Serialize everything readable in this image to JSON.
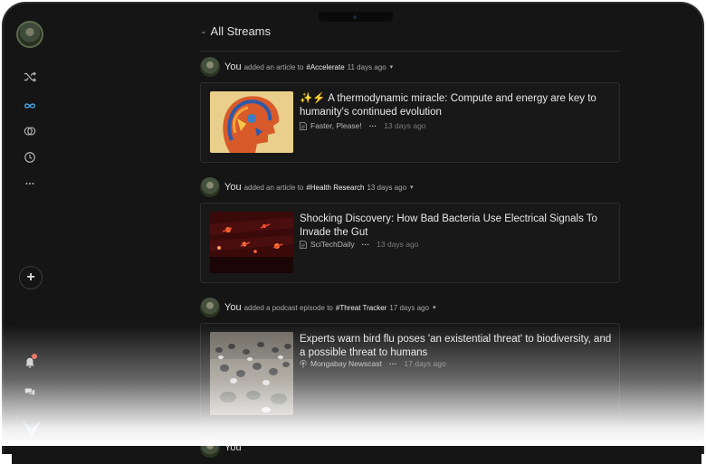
{
  "header": {
    "title": "All Streams"
  },
  "sidebar": {
    "items": [
      {
        "icon": "shuffle-icon"
      },
      {
        "icon": "infinity-icon"
      },
      {
        "icon": "rings-icon"
      },
      {
        "icon": "clock-icon"
      },
      {
        "icon": "more-icon"
      }
    ],
    "add_label": "+",
    "bottom": [
      {
        "icon": "bell-icon"
      },
      {
        "icon": "chat-icon"
      }
    ]
  },
  "posts": [
    {
      "user": "You",
      "action": "added an article to",
      "tag": "#Accelerate",
      "time": "11 days ago",
      "title": "✨⚡ A thermodynamic miracle: Compute and energy are key to humanity's continued evolution",
      "source": "Faster, Please!",
      "source_icon": "document-icon",
      "ago": "13 days ago"
    },
    {
      "user": "You",
      "action": "added an article to",
      "tag": "#Health Research",
      "time": "13 days ago",
      "title": "Shocking Discovery: How Bad Bacteria Use Electrical Signals To Invade the Gut",
      "source": "SciTechDaily",
      "source_icon": "document-icon",
      "ago": "13 days ago"
    },
    {
      "user": "You",
      "action": "added a podcast episode to",
      "tag": "#Threat Tracker",
      "time": "17 days ago",
      "title": "Experts warn bird flu poses 'an existential threat' to biodiversity, and a possible threat to humans",
      "source": "Mongabay Newscast",
      "source_icon": "podcast-icon",
      "ago": "17 days ago"
    },
    {
      "user": "You"
    }
  ],
  "colors": {
    "background": "#151515",
    "card": "#181818",
    "accent": "#4aa8e8",
    "notification": "#e35a4a"
  }
}
